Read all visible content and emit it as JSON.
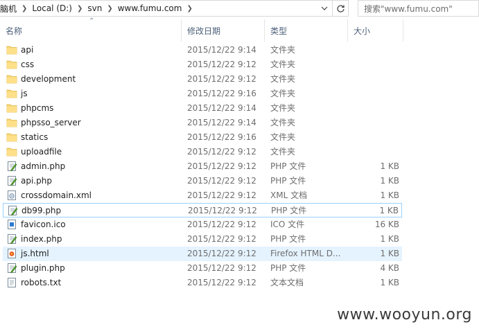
{
  "address": {
    "crumbs": [
      "脑机",
      "Local (D:)",
      "svn",
      "www.fumu.com"
    ],
    "dropdown_icon": "chevron-down-icon",
    "refresh_icon": "refresh-icon"
  },
  "search": {
    "placeholder": "搜索\"www.fumu.com\""
  },
  "columns": {
    "name": "名称",
    "date": "修改日期",
    "type": "类型",
    "size": "大小"
  },
  "files": [
    {
      "name": "api",
      "date": "2015/12/22 9:14",
      "type": "文件夹",
      "size": "",
      "icon": "folder-icon"
    },
    {
      "name": "css",
      "date": "2015/12/22 9:12",
      "type": "文件夹",
      "size": "",
      "icon": "folder-icon"
    },
    {
      "name": "development",
      "date": "2015/12/22 9:12",
      "type": "文件夹",
      "size": "",
      "icon": "folder-icon"
    },
    {
      "name": "js",
      "date": "2015/12/22 9:16",
      "type": "文件夹",
      "size": "",
      "icon": "folder-icon"
    },
    {
      "name": "phpcms",
      "date": "2015/12/22 9:14",
      "type": "文件夹",
      "size": "",
      "icon": "folder-icon"
    },
    {
      "name": "phpsso_server",
      "date": "2015/12/22 9:14",
      "type": "文件夹",
      "size": "",
      "icon": "folder-icon"
    },
    {
      "name": "statics",
      "date": "2015/12/22 9:16",
      "type": "文件夹",
      "size": "",
      "icon": "folder-icon"
    },
    {
      "name": "uploadfile",
      "date": "2015/12/22 9:12",
      "type": "文件夹",
      "size": "",
      "icon": "folder-icon"
    },
    {
      "name": "admin.php",
      "date": "2015/12/22 9:12",
      "type": "PHP 文件",
      "size": "1 KB",
      "icon": "php-file-icon"
    },
    {
      "name": "api.php",
      "date": "2015/12/22 9:12",
      "type": "PHP 文件",
      "size": "1 KB",
      "icon": "php-file-icon"
    },
    {
      "name": "crossdomain.xml",
      "date": "2015/12/22 9:12",
      "type": "XML 文档",
      "size": "1 KB",
      "icon": "xml-file-icon"
    },
    {
      "name": "db99.php",
      "date": "2015/12/22 9:12",
      "type": "PHP 文件",
      "size": "1 KB",
      "icon": "php-file-icon",
      "state": "focused"
    },
    {
      "name": "favicon.ico",
      "date": "2015/12/22 9:12",
      "type": "ICO 文件",
      "size": "16 KB",
      "icon": "ico-file-icon"
    },
    {
      "name": "index.php",
      "date": "2015/12/22 9:12",
      "type": "PHP 文件",
      "size": "1 KB",
      "icon": "php-file-icon"
    },
    {
      "name": "js.html",
      "date": "2015/12/22 9:12",
      "type": "Firefox HTML D...",
      "size": "1 KB",
      "icon": "html-file-icon",
      "state": "hover"
    },
    {
      "name": "plugin.php",
      "date": "2015/12/22 9:12",
      "type": "PHP 文件",
      "size": "4 KB",
      "icon": "php-file-icon"
    },
    {
      "name": "robots.txt",
      "date": "2015/12/22 9:12",
      "type": "文本文档",
      "size": "1 KB",
      "icon": "text-file-icon"
    }
  ],
  "watermark": "www.wooyun.org"
}
